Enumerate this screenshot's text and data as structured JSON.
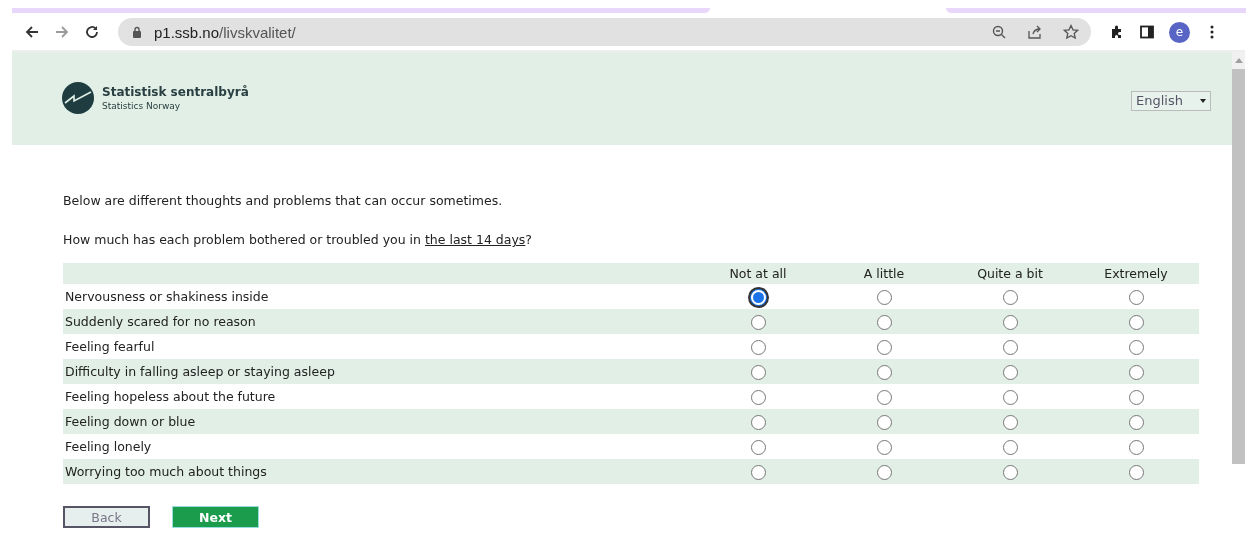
{
  "browser": {
    "url_host": "p1.ssb.no",
    "url_path": "/livskvalitet/",
    "profile_initial": "e"
  },
  "header": {
    "logo_title": "Statistisk sentralbyrå",
    "logo_subtitle": "Statistics Norway",
    "language": "English"
  },
  "intro": "Below are different thoughts and problems that can occur sometimes.",
  "question": {
    "before": "How much has each problem bothered or troubled you in ",
    "underlined": "the last 14 days",
    "after": "?"
  },
  "columns": [
    "Not at all",
    "A little",
    "Quite a bit",
    "Extremely"
  ],
  "rows": [
    {
      "label": "Nervousness or shakiness inside",
      "options": [
        {
          "selected": true
        },
        {
          "selected": false
        },
        {
          "selected": false
        },
        {
          "selected": false
        }
      ]
    },
    {
      "label": "Suddenly scared for no reason",
      "options": [
        {
          "selected": false
        },
        {
          "selected": false
        },
        {
          "selected": false
        },
        {
          "selected": false
        }
      ]
    },
    {
      "label": "Feeling fearful",
      "options": [
        {
          "selected": false
        },
        {
          "selected": false
        },
        {
          "selected": false
        },
        {
          "selected": false
        }
      ]
    },
    {
      "label": "Difficulty in falling asleep or staying asleep",
      "options": [
        {
          "selected": false
        },
        {
          "selected": false
        },
        {
          "selected": false
        },
        {
          "selected": false
        }
      ]
    },
    {
      "label": "Feeling hopeless about the future",
      "options": [
        {
          "selected": false
        },
        {
          "selected": false
        },
        {
          "selected": false
        },
        {
          "selected": false
        }
      ]
    },
    {
      "label": "Feeling down or blue",
      "options": [
        {
          "selected": false
        },
        {
          "selected": false
        },
        {
          "selected": false
        },
        {
          "selected": false
        }
      ]
    },
    {
      "label": "Feeling lonely",
      "options": [
        {
          "selected": false
        },
        {
          "selected": false
        },
        {
          "selected": false
        },
        {
          "selected": false
        }
      ]
    },
    {
      "label": "Worrying too much about things",
      "options": [
        {
          "selected": false
        },
        {
          "selected": false
        },
        {
          "selected": false
        },
        {
          "selected": false
        }
      ]
    }
  ],
  "buttons": {
    "back": "Back",
    "next": "Next"
  }
}
